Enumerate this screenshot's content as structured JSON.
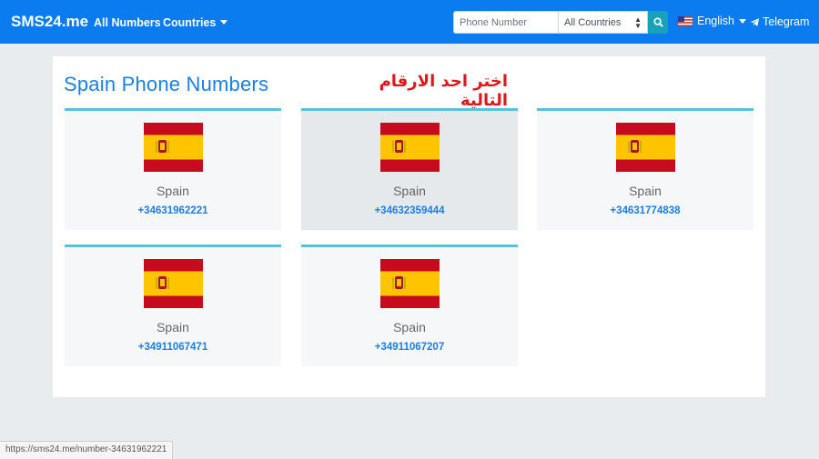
{
  "navbar": {
    "brand": "SMS24.me",
    "all_numbers": "All Numbers",
    "countries": "Countries",
    "search_placeholder": "Phone Number",
    "country_select": "All Countries",
    "language": "English",
    "telegram": "Telegram"
  },
  "page": {
    "title": "Spain Phone Numbers",
    "arabic_note": "اختر احد الارقام التالية"
  },
  "numbers": [
    {
      "country": "Spain",
      "number": "+34631962221"
    },
    {
      "country": "Spain",
      "number": "+34632359444"
    },
    {
      "country": "Spain",
      "number": "+34631774838"
    },
    {
      "country": "Spain",
      "number": "+34911067471"
    },
    {
      "country": "Spain",
      "number": "+34911067207"
    }
  ],
  "status_bar": {
    "url": "https://sms24.me/number-34631962221"
  },
  "colors": {
    "navbar": "#0b7bf0",
    "accent": "#1a7fe6",
    "card_border": "#5bc0de",
    "search_button": "#17a2b8",
    "arabic_text": "#e0161a"
  }
}
